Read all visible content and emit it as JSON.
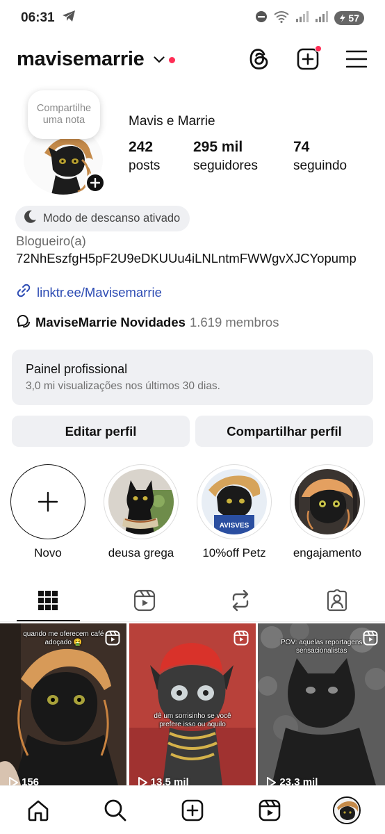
{
  "status_bar": {
    "time": "06:31",
    "battery": "57"
  },
  "header": {
    "username": "mavisemarrie"
  },
  "profile": {
    "note": "Compartilhe uma nota",
    "display_name": "Mavis e Marrie",
    "stats": [
      {
        "value": "242",
        "label": "posts"
      },
      {
        "value": "295 mil",
        "label": "seguidores"
      },
      {
        "value": "74",
        "label": "seguindo"
      }
    ]
  },
  "bio": {
    "rest_mode": "Modo de descanso ativado",
    "category": "Blogueiro(a)",
    "text": "72NhEszfgH5pF2U9eDKUUu4iLNLntmFWWgvXJCYopump",
    "link": "linktr.ee/Mavisemarrie",
    "channel_name": "MaviseMarrie Novidades",
    "channel_members": "1.619 membros"
  },
  "dashboard": {
    "title": "Painel profissional",
    "subtitle": "3,0 mi visualizações nos últimos 30 dias."
  },
  "buttons": {
    "edit": "Editar perfil",
    "share": "Compartilhar perfil"
  },
  "highlights": [
    {
      "label": "Novo"
    },
    {
      "label": "deusa grega"
    },
    {
      "label": "10%off Petz"
    },
    {
      "label": "engajamento"
    }
  ],
  "highlight_text": {
    "petz_banner": "AVISVES"
  },
  "grid": [
    {
      "caption": "quando me oferecem café adoçado 🤮",
      "views": "156"
    },
    {
      "caption": "dê um sorrisinho se você prefere isso ou aquilo",
      "views": "13,5 mil"
    },
    {
      "caption": "POV: aquelas reportagens sensacionalistas",
      "views": "23,3 mil"
    }
  ]
}
